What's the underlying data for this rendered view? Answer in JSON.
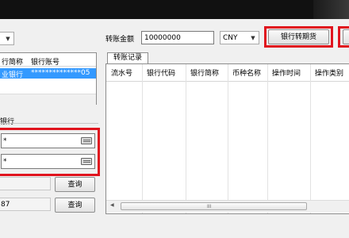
{
  "window": {
    "title": ""
  },
  "toolbar": {
    "amount_label": "转账金额",
    "amount_value": "10000000",
    "currency_value": "CNY",
    "transfer_button": "银行转期货",
    "dropdown_arrow": "▼"
  },
  "bank_table": {
    "headers": [
      "行简称",
      "银行账号"
    ],
    "selected_row": {
      "bank": "业银行",
      "account": "**************05"
    }
  },
  "bank_section": {
    "label": "银行"
  },
  "password_fields": [
    {
      "value": "*"
    },
    {
      "value": "*"
    }
  ],
  "query_rows": [
    {
      "value": "",
      "button": "查询"
    },
    {
      "value": "87",
      "button": "查询"
    }
  ],
  "records": {
    "tab": "转账记录",
    "columns": [
      "流水号",
      "银行代码",
      "银行简称",
      "币种名称",
      "操作时间",
      "操作类别"
    ]
  },
  "scrollbar": {
    "grip": "III",
    "left_arrow": "◀"
  },
  "colors": {
    "highlight": "#e0141e",
    "selection": "#3399ff"
  },
  "icons": [
    "keyboard-icon",
    "dropdown-arrow-icon",
    "scroll-left-icon"
  ]
}
